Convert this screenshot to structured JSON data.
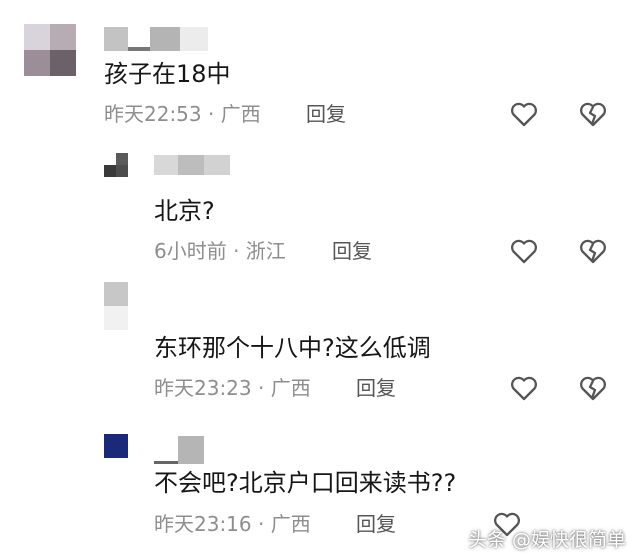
{
  "comments": [
    {
      "text": "孩子在18中",
      "time_location": "昨天22:53 · 广西",
      "reply_label": "回复"
    },
    {
      "text": "北京?",
      "time_location": "6小时前 · 浙江",
      "reply_label": "回复"
    },
    {
      "text": "东环那个十八中?这么低调",
      "time_location": "昨天23:23 · 广西",
      "reply_label": "回复"
    },
    {
      "text": "不会吧?北京户口回来读书??",
      "time_location": "昨天23:16 · 广西",
      "reply_label": "回复"
    }
  ],
  "icons": {
    "like": "heart-outline-icon",
    "dislike": "broken-heart-icon"
  },
  "watermark": "头条 @娱快很简单",
  "colors": {
    "text": "#161616",
    "meta": "#8e8e8e",
    "icon": "#555555",
    "background": "#ffffff"
  }
}
